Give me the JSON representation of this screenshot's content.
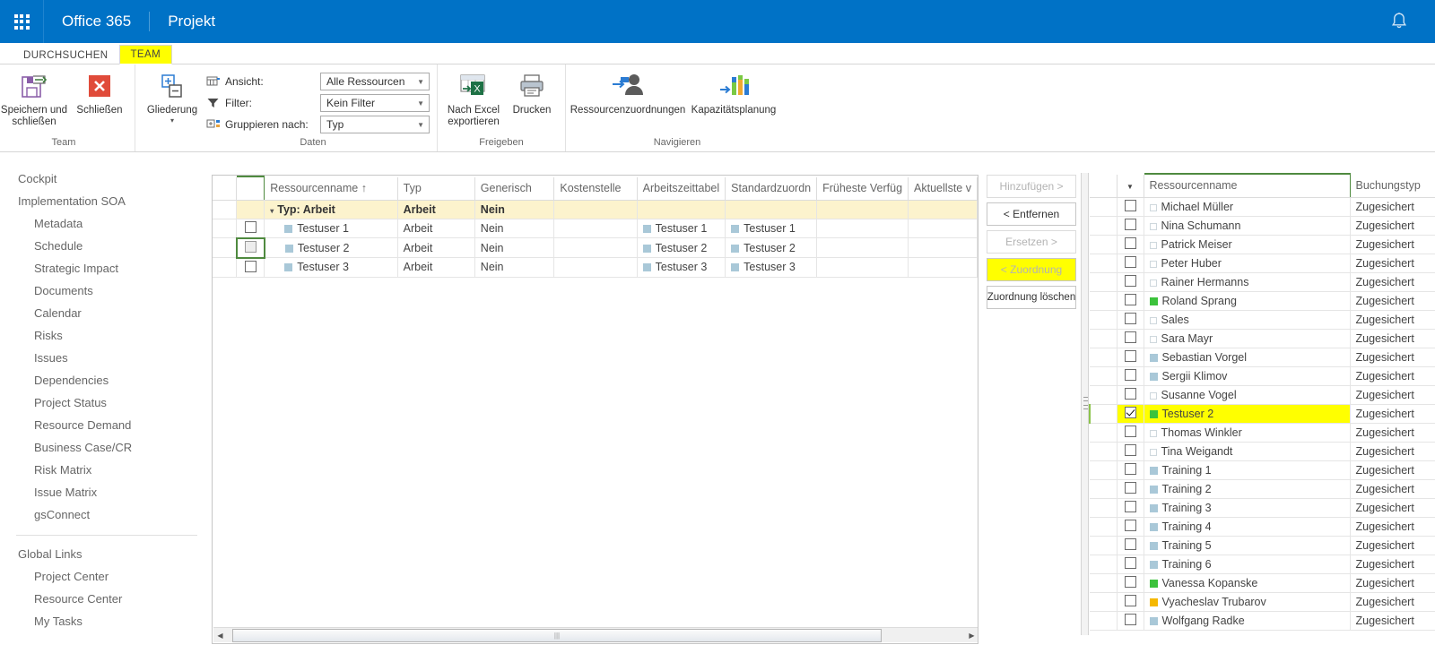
{
  "suitebar": {
    "waffle_title": "app-launcher",
    "office_label": "Office 365",
    "app_label": "Projekt",
    "bell_title": "notifications"
  },
  "ribbon": {
    "tabs": [
      {
        "label": "DURCHSUCHEN",
        "active": false
      },
      {
        "label": "TEAM",
        "active": true
      }
    ],
    "groups": [
      {
        "name": "Team",
        "label": "Team",
        "buttons": [
          {
            "label": "Speichern und schließen",
            "icon": "save-close-icon"
          },
          {
            "label": "Schließen",
            "icon": "close-x-icon"
          }
        ]
      },
      {
        "name": "Daten",
        "label": "Daten",
        "buttons": [
          {
            "label": "Gliederung",
            "icon": "outline-icon"
          }
        ],
        "fields": [
          {
            "label": "Ansicht:",
            "icon": "view-icon",
            "value": "Alle Ressourcen"
          },
          {
            "label": "Filter:",
            "icon": "filter-icon",
            "value": "Kein Filter"
          },
          {
            "label": "Gruppieren nach:",
            "icon": "group-icon",
            "value": "Typ"
          }
        ]
      },
      {
        "name": "Freigeben",
        "label": "Freigeben",
        "buttons": [
          {
            "label": "Nach Excel exportieren",
            "icon": "excel-export-icon"
          },
          {
            "label": "Drucken",
            "icon": "printer-icon"
          }
        ]
      },
      {
        "name": "Navigieren",
        "label": "Navigieren",
        "buttons": [
          {
            "label": "Ressourcenzuordnungen",
            "icon": "resource-assignment-icon"
          },
          {
            "label": "Kapazitätsplanung",
            "icon": "capacity-planning-icon"
          }
        ]
      }
    ]
  },
  "sidebar": {
    "items": [
      {
        "label": "Cockpit",
        "level": 0
      },
      {
        "label": "Implementation SOA",
        "level": 0
      },
      {
        "label": "Metadata",
        "level": 1
      },
      {
        "label": "Schedule",
        "level": 1
      },
      {
        "label": "Strategic Impact",
        "level": 1
      },
      {
        "label": "Documents",
        "level": 1
      },
      {
        "label": "Calendar",
        "level": 1
      },
      {
        "label": "Risks",
        "level": 1
      },
      {
        "label": "Issues",
        "level": 1
      },
      {
        "label": "Dependencies",
        "level": 1
      },
      {
        "label": "Project Status",
        "level": 1
      },
      {
        "label": "Resource Demand",
        "level": 1
      },
      {
        "label": "Business Case/CR",
        "level": 1
      },
      {
        "label": "Risk Matrix",
        "level": 1
      },
      {
        "label": "Issue Matrix",
        "level": 1
      },
      {
        "label": "gsConnect",
        "level": 1
      }
    ],
    "group2_title": "Global Links",
    "group2_items": [
      {
        "label": "Project Center",
        "level": 1
      },
      {
        "label": "Resource Center",
        "level": 1
      },
      {
        "label": "My Tasks",
        "level": 1
      }
    ]
  },
  "team_grid": {
    "columns": [
      "Ressourcenname ↑",
      "Typ",
      "Generisch",
      "Kostenstelle",
      "Arbeitszeittabel",
      "Standardzuordn",
      "Früheste Verfüg",
      "Aktuellste v"
    ],
    "group_row": {
      "label": "Typ: Arbeit",
      "typ": "Arbeit",
      "generisch": "Nein"
    },
    "rows": [
      {
        "checked": false,
        "selected": false,
        "name": "Testuser 1",
        "swatch": "blue",
        "typ": "Arbeit",
        "generisch": "Nein",
        "kostenstelle": "",
        "arbeitszeittabelle": "Testuser 1",
        "standardzuordnung": "Testuser 1",
        "frueheste": "",
        "aktuellste": ""
      },
      {
        "checked": false,
        "selected": true,
        "name": "Testuser 2",
        "swatch": "blue",
        "typ": "Arbeit",
        "generisch": "Nein",
        "kostenstelle": "",
        "arbeitszeittabelle": "Testuser 2",
        "standardzuordnung": "Testuser 2",
        "frueheste": "",
        "aktuellste": ""
      },
      {
        "checked": false,
        "selected": false,
        "name": "Testuser 3",
        "swatch": "blue",
        "typ": "Arbeit",
        "generisch": "Nein",
        "kostenstelle": "",
        "arbeitszeittabelle": "Testuser 3",
        "standardzuordnung": "Testuser 3",
        "frueheste": "",
        "aktuellste": ""
      }
    ]
  },
  "transfer_buttons": [
    {
      "label": "Hinzufügen >",
      "state": "disabled",
      "highlight": false
    },
    {
      "label": "< Entfernen",
      "state": "enabled",
      "highlight": false
    },
    {
      "label": "Ersetzen >",
      "state": "disabled",
      "highlight": false
    },
    {
      "label": "< Zuordnung",
      "state": "disabled",
      "highlight": true
    },
    {
      "label": "Zuordnung löschen",
      "state": "enabled",
      "highlight": false
    }
  ],
  "resource_grid": {
    "columns": [
      "Ressourcenname",
      "Buchungstyp"
    ],
    "rows": [
      {
        "name": "Michael Müller",
        "swatch": "empty",
        "booking": "Zugesichert",
        "checked": false,
        "highlight": false
      },
      {
        "name": "Nina Schumann",
        "swatch": "empty",
        "booking": "Zugesichert",
        "checked": false,
        "highlight": false
      },
      {
        "name": "Patrick Meiser",
        "swatch": "empty",
        "booking": "Zugesichert",
        "checked": false,
        "highlight": false
      },
      {
        "name": "Peter Huber",
        "swatch": "empty",
        "booking": "Zugesichert",
        "checked": false,
        "highlight": false
      },
      {
        "name": "Rainer Hermanns",
        "swatch": "empty",
        "booking": "Zugesichert",
        "checked": false,
        "highlight": false
      },
      {
        "name": "Roland Sprang",
        "swatch": "green",
        "booking": "Zugesichert",
        "checked": false,
        "highlight": false
      },
      {
        "name": "Sales",
        "swatch": "empty",
        "booking": "Zugesichert",
        "checked": false,
        "highlight": false
      },
      {
        "name": "Sara Mayr",
        "swatch": "empty",
        "booking": "Zugesichert",
        "checked": false,
        "highlight": false
      },
      {
        "name": "Sebastian Vorgel",
        "swatch": "blue",
        "booking": "Zugesichert",
        "checked": false,
        "highlight": false
      },
      {
        "name": "Sergii Klimov",
        "swatch": "blue",
        "booking": "Zugesichert",
        "checked": false,
        "highlight": false
      },
      {
        "name": "Susanne Vogel",
        "swatch": "empty",
        "booking": "Zugesichert",
        "checked": false,
        "highlight": false
      },
      {
        "name": "Testuser 2",
        "swatch": "green",
        "booking": "Zugesichert",
        "checked": true,
        "highlight": true
      },
      {
        "name": "Thomas Winkler",
        "swatch": "empty",
        "booking": "Zugesichert",
        "checked": false,
        "highlight": false
      },
      {
        "name": "Tina Weigandt",
        "swatch": "empty",
        "booking": "Zugesichert",
        "checked": false,
        "highlight": false
      },
      {
        "name": "Training 1",
        "swatch": "blue",
        "booking": "Zugesichert",
        "checked": false,
        "highlight": false
      },
      {
        "name": "Training 2",
        "swatch": "blue",
        "booking": "Zugesichert",
        "checked": false,
        "highlight": false
      },
      {
        "name": "Training 3",
        "swatch": "blue",
        "booking": "Zugesichert",
        "checked": false,
        "highlight": false
      },
      {
        "name": "Training 4",
        "swatch": "blue",
        "booking": "Zugesichert",
        "checked": false,
        "highlight": false
      },
      {
        "name": "Training 5",
        "swatch": "blue",
        "booking": "Zugesichert",
        "checked": false,
        "highlight": false
      },
      {
        "name": "Training 6",
        "swatch": "blue",
        "booking": "Zugesichert",
        "checked": false,
        "highlight": false
      },
      {
        "name": "Vanessa Kopanske",
        "swatch": "green",
        "booking": "Zugesichert",
        "checked": false,
        "highlight": false
      },
      {
        "name": "Vyacheslav Trubarov",
        "swatch": "amber",
        "booking": "Zugesichert",
        "checked": false,
        "highlight": false
      },
      {
        "name": "Wolfgang Radke",
        "swatch": "blue",
        "booking": "Zugesichert",
        "checked": false,
        "highlight": false
      }
    ]
  },
  "colors": {
    "suitebar": "#0072c6",
    "highlight": "#ffff00",
    "group_row": "#fcf3cd",
    "swatch_blue": "#a9c8d8",
    "swatch_green": "#3cc23c",
    "swatch_amber": "#f5b800",
    "selection_green": "#4f8a3f"
  }
}
